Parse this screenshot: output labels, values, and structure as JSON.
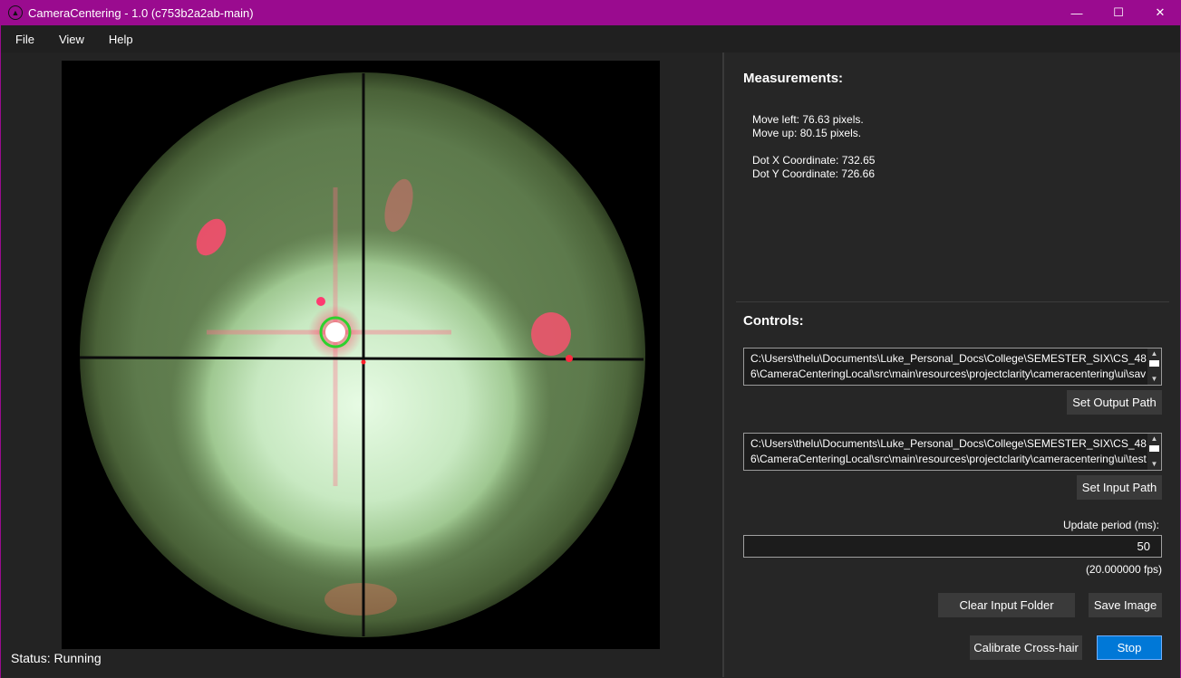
{
  "window": {
    "title": "CameraCentering - 1.0 (c753b2a2ab-main)",
    "minimize_glyph": "—",
    "maximize_glyph": "☐",
    "close_glyph": "✕"
  },
  "menu": [
    "File",
    "View",
    "Help"
  ],
  "status": "Status: Running",
  "measurements": {
    "title": "Measurements:",
    "move_left": "Move left: 76.63 pixels.",
    "move_up": "Move up: 80.15 pixels.",
    "dot_x": "Dot X Coordinate: 732.65",
    "dot_y": "Dot Y Coordinate: 726.66"
  },
  "controls": {
    "title": "Controls:",
    "output_path": "C:\\Users\\thelu\\Documents\\Luke_Personal_Docs\\College\\SEMESTER_SIX\\CS_486\\CameraCenteringLocal\\src\\main\\resources\\projectclarity\\cameracentering\\ui\\save",
    "set_output_label": "Set Output Path",
    "input_path": "C:\\Users\\thelu\\Documents\\Luke_Personal_Docs\\College\\SEMESTER_SIX\\CS_486\\CameraCenteringLocal\\src\\main\\resources\\projectclarity\\cameracentering\\ui\\test-i",
    "set_input_label": "Set Input Path",
    "update_period_label": "Update period (ms):",
    "update_period_value": "50",
    "fps_label": "(20.000000 fps)",
    "clear_input_label": "Clear Input Folder",
    "save_image_label": "Save Image",
    "calibrate_label": "Calibrate Cross-hair",
    "stop_label": "Stop"
  },
  "colors": {
    "titlebar": "#9a0b8f",
    "accent_button": "#0078d7",
    "detection_ring": "#2ed12e"
  }
}
